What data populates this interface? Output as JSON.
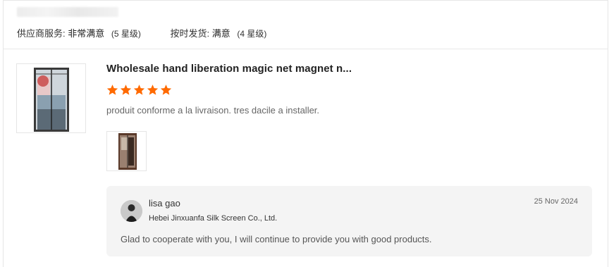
{
  "supplier_ratings": {
    "service_label": "供应商服务:",
    "service_value": "非常满意",
    "service_stars": "(5 星级)",
    "delivery_label": "按时发货:",
    "delivery_value": "满意",
    "delivery_stars": "(4 星级)"
  },
  "review": {
    "product_title": "Wholesale hand liberation magic net magnet n...",
    "rating": 5,
    "rating_max": 5,
    "star_color": "#ff6a00",
    "text": "produit conforme a la livraison. tres dacile a installer."
  },
  "reply": {
    "name": "lisa gao",
    "company": "Hebei Jinxuanfa Silk Screen Co., Ltd.",
    "date": "25 Nov 2024",
    "text": "Glad to cooperate with you, I will continue to provide you with good products."
  }
}
